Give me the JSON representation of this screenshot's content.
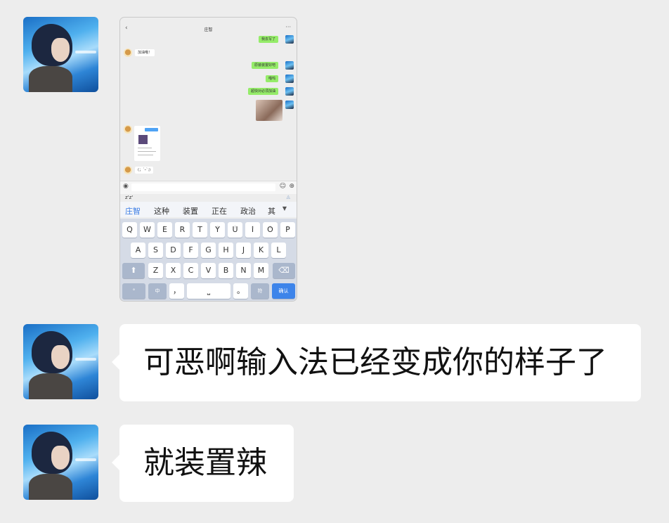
{
  "phone_screenshot": {
    "title": "庄智",
    "back_icon": "‹",
    "more_icon": "···",
    "messages": [
      {
        "side": "me",
        "text": "我去写了"
      },
      {
        "side": "other",
        "text": "加油哦！"
      },
      {
        "side": "me",
        "text": "原装装置好吧"
      },
      {
        "side": "me",
        "text": "喵呜"
      },
      {
        "side": "me",
        "text": "超快对必须加油"
      },
      {
        "side": "other",
        "text": "(；´ｰ`;)"
      }
    ],
    "input": {
      "voice_icon": "◉",
      "emoji_icon": "☺",
      "plus_icon": "⊕"
    },
    "ime": {
      "code": "z'z'",
      "candidates": [
        "庄智",
        "这种",
        "装置",
        "正在",
        "政治",
        "其"
      ],
      "expand_icon": "▼",
      "row1": [
        "Q",
        "W",
        "E",
        "R",
        "T",
        "Y",
        "U",
        "I",
        "O",
        "P"
      ],
      "row1_sup": [
        "1",
        "2",
        "3",
        "4",
        "5",
        "6",
        "7",
        "8",
        "9",
        "0"
      ],
      "row2": [
        "A",
        "S",
        "D",
        "F",
        "G",
        "H",
        "J",
        "K",
        "L"
      ],
      "row3": [
        "Z",
        "X",
        "C",
        "V",
        "B",
        "N",
        "M"
      ],
      "shift": "⬆",
      "backspace": "⌫",
      "symbol_key": "°",
      "lang_key": "中",
      "comma_key": "，",
      "space_key": "⎵",
      "period_key": "。",
      "symbols_key": "符",
      "enter_key": "确认"
    }
  },
  "chat": {
    "bubble1": "可恶啊输入法已经变成你的样子了",
    "bubble2": "就装置辣"
  }
}
